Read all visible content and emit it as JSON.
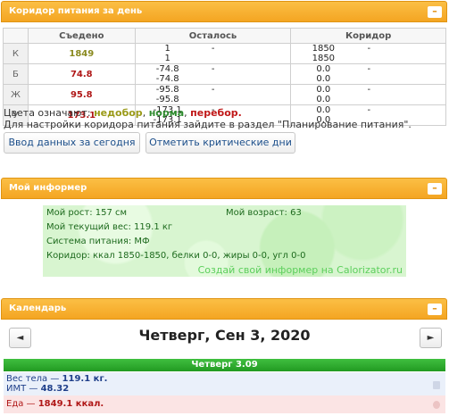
{
  "corridor": {
    "title": "Коридор питания за день",
    "headers": {
      "eaten": "Съедено",
      "remaining": "Осталось",
      "corridor": "Коридор"
    },
    "rows": [
      {
        "label": "К",
        "eaten": "1849",
        "rem_a": "1",
        "rem_b": "1",
        "cor_a": "1850",
        "cor_b": "1850",
        "sep": "-"
      },
      {
        "label": "Б",
        "eaten": "74.8",
        "rem_a": "-74.8",
        "rem_b": "-74.8",
        "cor_a": "0.0",
        "cor_b": "0.0",
        "sep": "-"
      },
      {
        "label": "Ж",
        "eaten": "95.8",
        "rem_a": "-95.8",
        "rem_b": "-95.8",
        "cor_a": "0.0",
        "cor_b": "0.0",
        "sep": "-"
      },
      {
        "label": "У",
        "eaten": "173.1",
        "rem_a": "-173.1",
        "rem_b": "-173.1",
        "cor_a": "0.0",
        "cor_b": "0.0",
        "sep": "-"
      }
    ],
    "legend_prefix": "Цвета означают:",
    "legend_under": "недобор",
    "legend_norm": "норма",
    "legend_over": "перебор.",
    "legend_sep": ",",
    "hint": "Для настройки коридора питания зайдите в раздел \"Планирование питания\".",
    "btn_today": "Ввод данных за сегодня",
    "btn_critical": "Отметить критические дни",
    "toggle": "–"
  },
  "informer": {
    "title": "Мой информер",
    "height": "Мой рост: 157 см",
    "age": "Мой возраст: 63",
    "weight": "Мой текущий вес: 119.1 кг",
    "system": "Система питания: МФ",
    "corridor": "Коридор: ккал 1850-1850, белки 0-0, жиры 0-0, угл 0-0",
    "link": "Создай свой информер на Calorizator.ru",
    "toggle": "–"
  },
  "calendar": {
    "title": "Календарь",
    "toggle": "–",
    "prev": "◄",
    "next": "►",
    "date": "Четверг, Сен 3, 2020",
    "day_head": "Четверг 3.09",
    "weight_label": "Вес тела — ",
    "weight_value": "119.1 кг.",
    "bmi_label": "ИМТ — ",
    "bmi_value": "48.32",
    "food_label": "Еда — ",
    "food_value": "1849.1 ккал."
  },
  "colors": {
    "header": "#f4a522",
    "informer_bg": "#d8f5d0",
    "day_head": "#229a22",
    "over": "#b01818",
    "under": "#9a9a18",
    "norm": "#2e8b2e"
  }
}
